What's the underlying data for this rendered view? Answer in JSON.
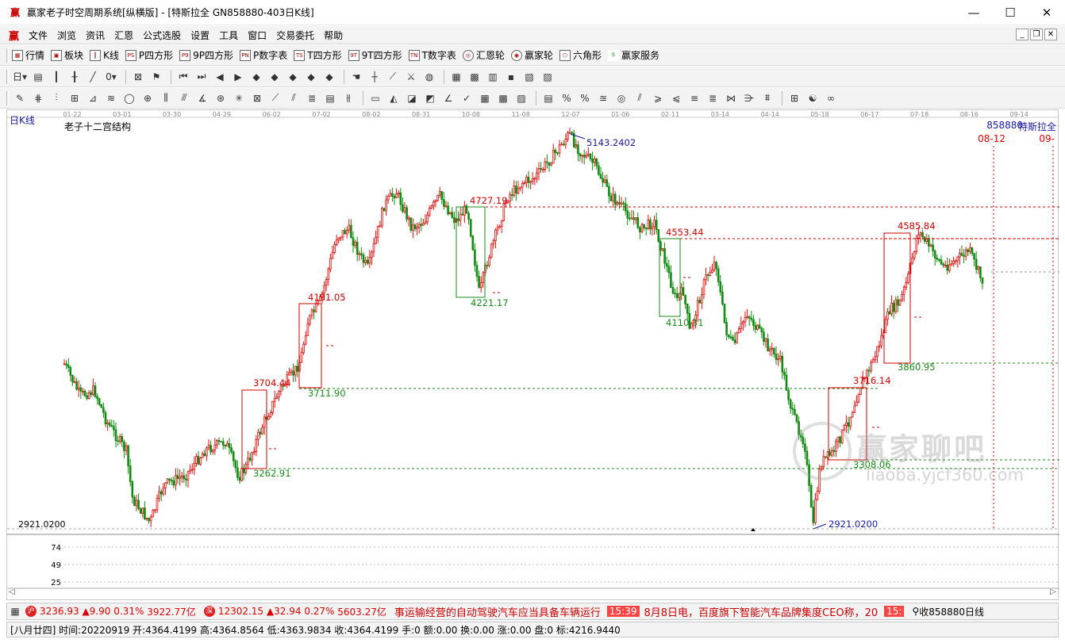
{
  "window": {
    "title": "赢家老子时空周期系统[纵横版] - [特斯拉全   GN858880-403日K线]",
    "min": "—",
    "max": "☐",
    "close": "✕"
  },
  "menu": {
    "logo": "赢",
    "items": [
      "文件",
      "浏览",
      "资讯",
      "汇恩",
      "公式选股",
      "设置",
      "工具",
      "窗口",
      "交易委托",
      "帮助"
    ]
  },
  "toolbar1": [
    {
      "icon": "grid-icon",
      "label": "行情"
    },
    {
      "icon": "blocks-icon",
      "label": "板块"
    },
    {
      "icon": "candle-icon",
      "label": "K线"
    },
    {
      "icon": "PS",
      "label": "P四方形"
    },
    {
      "icon": "P9",
      "label": "9P四方形"
    },
    {
      "icon": "PN",
      "label": "P数字表"
    },
    {
      "icon": "TS",
      "label": "T四方形"
    },
    {
      "icon": "9T",
      "label": "9T四方形"
    },
    {
      "icon": "TN",
      "label": "T数字表"
    },
    {
      "icon": "wheel-icon",
      "label": "汇恩轮"
    },
    {
      "icon": "wheel2-icon",
      "label": "赢家轮"
    },
    {
      "icon": "hexagon-icon",
      "label": "六角形"
    },
    {
      "icon": "dollar-icon",
      "label": "赢家服务"
    }
  ],
  "chart": {
    "period_label": "日K线",
    "indicator_title": "老子十二宫结构",
    "stock_code": "858880",
    "stock_name": "特斯拉全",
    "date_top1": "08-12",
    "date_top2": "09-",
    "min_label": "2921.0200",
    "time_axis": [
      "01-22",
      "03-01",
      "03-30",
      "04-29",
      "06-02",
      "07-02",
      "08-02",
      "08-31",
      "10-08",
      "11-08",
      "12-07",
      "01-06",
      "02-11",
      "03-14",
      "04-14",
      "05-18",
      "06-17",
      "07-18",
      "08-16",
      "09-14"
    ],
    "sub_axis": [
      "74",
      "49",
      "25"
    ],
    "levels": [
      {
        "text": "5143.2402",
        "color": "#1a1aa0"
      },
      {
        "text": "4727.19",
        "color": "#d00000"
      },
      {
        "text": "4553.44",
        "color": "#d00000"
      },
      {
        "text": "4585.84",
        "color": "#d00000"
      },
      {
        "text": "4221.17",
        "color": "#1a8a1a"
      },
      {
        "text": "4110.31",
        "color": "#1a8a1a"
      },
      {
        "text": "4191.05",
        "color": "#d00000"
      },
      {
        "text": "3860.95",
        "color": "#1a8a1a"
      },
      {
        "text": "3704.44",
        "color": "#d00000"
      },
      {
        "text": "3711.90",
        "color": "#1a8a1a"
      },
      {
        "text": "3716.14",
        "color": "#d00000"
      },
      {
        "text": "3308.06",
        "color": "#1a8a1a"
      },
      {
        "text": "3262.91",
        "color": "#1a8a1a"
      },
      {
        "text": "2921.0200",
        "color": "#1a1aa0"
      }
    ],
    "watermark_main": "赢家聊吧",
    "watermark_sub": "liaoba.yjcf360.com"
  },
  "status": {
    "idx1_value": "3236.93",
    "idx1_change": "▲9.90",
    "idx1_pct": "0.31%",
    "idx1_amount": "3922.77亿",
    "idx2_value": "12302.15",
    "idx2_change": "▲32.94",
    "idx2_pct": "0.27%",
    "idx2_amount": "5603.27亿",
    "news1": "事运输经营的自动驾驶汽车应当具备车辆运行",
    "clock1": "15:39",
    "news2": "8月8日电，百度旗下智能汽车品牌集度CEO称，20",
    "clock2": "15:",
    "right": "收858880日线"
  },
  "bottom": {
    "text": "[八月廿四] 时间:20220919 开:4364.4199 高:4364.8564 低:4363.9834 收:4364.4199 手:0 额:0.00 换:0.00 涨:0.00 盘:0 标:4216.9440"
  }
}
